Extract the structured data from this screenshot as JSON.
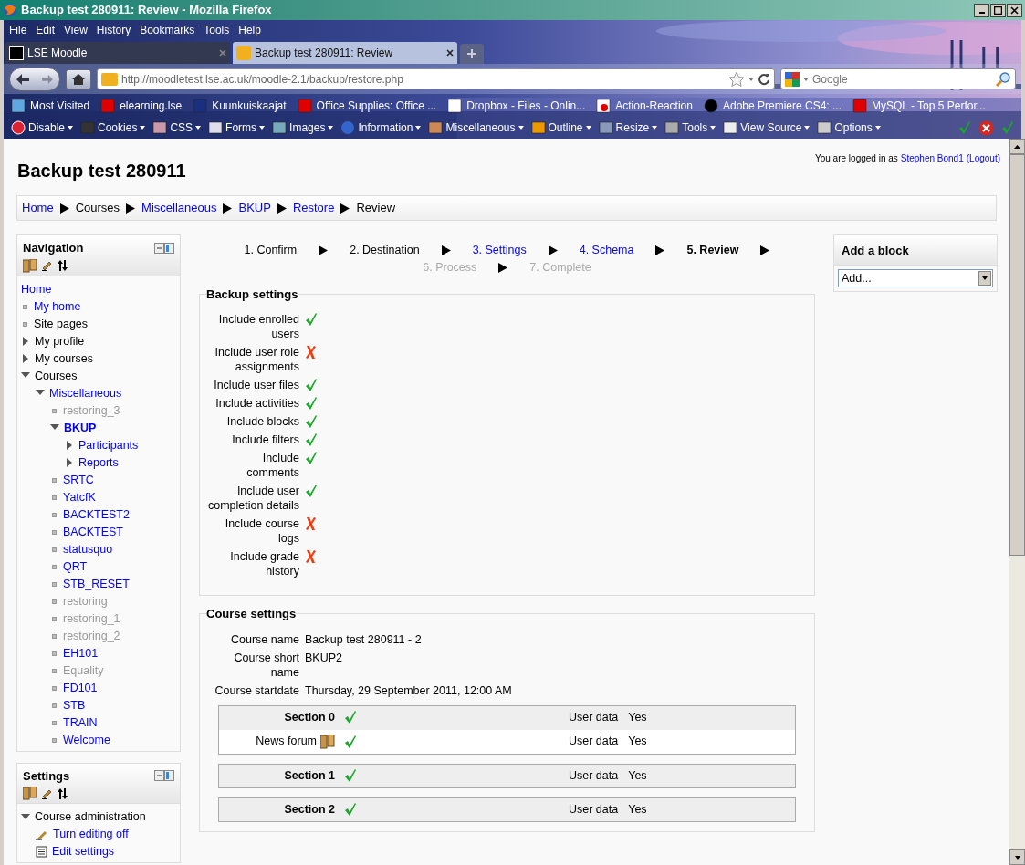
{
  "window": {
    "title": "Backup test 280911: Review - Mozilla Firefox"
  },
  "menu": [
    "File",
    "Edit",
    "View",
    "History",
    "Bookmarks",
    "Tools",
    "Help"
  ],
  "tabs": [
    {
      "label": "LSE Moodle",
      "selected": false
    },
    {
      "label": "Backup test 280911: Review",
      "selected": true
    }
  ],
  "address": {
    "url": "http://moodletest.lse.ac.uk/moodle-2.1/backup/restore.php"
  },
  "search": {
    "placeholder": "Google"
  },
  "bookmarks": [
    "Most Visited",
    "elearning.lse",
    "Kuunkuiskaajat",
    "Office Supplies: Office ...",
    "Dropbox - Files - Onlin...",
    "Action-Reaction",
    "Adobe Premiere CS4: ...",
    "MySQL - Top 5 Perfor..."
  ],
  "dev_toolbar": [
    "Disable",
    "Cookies",
    "CSS",
    "Forms",
    "Images",
    "Information",
    "Miscellaneous",
    "Outline",
    "Resize",
    "Tools",
    "View Source",
    "Options"
  ],
  "page": {
    "title": "Backup test 280911",
    "login_info": {
      "text": "You are logged in as",
      "user": "Stephen Bond1",
      "logout": "(Logout)"
    },
    "breadcrumb": [
      {
        "label": "Home",
        "link": true
      },
      {
        "label": "Courses",
        "link": false
      },
      {
        "label": "Miscellaneous",
        "link": true
      },
      {
        "label": "BKUP",
        "link": true
      },
      {
        "label": "Restore",
        "link": true
      },
      {
        "label": "Review",
        "link": false
      }
    ]
  },
  "navigation": {
    "title": "Navigation",
    "items": [
      {
        "label": "Home",
        "kind": "root"
      },
      {
        "label": "My home",
        "kind": "link"
      },
      {
        "label": "Site pages",
        "kind": "text"
      },
      {
        "label": "My profile",
        "kind": "text",
        "expanded": false
      },
      {
        "label": "My courses",
        "kind": "text",
        "expanded": false
      },
      {
        "label": "Courses",
        "kind": "text",
        "expanded": true,
        "children": [
          {
            "label": "Miscellaneous",
            "kind": "link",
            "expanded": true,
            "children": [
              {
                "label": "restoring_3",
                "kind": "dimmed"
              },
              {
                "label": "BKUP",
                "kind": "current",
                "expanded": true,
                "children": [
                  {
                    "label": "Participants",
                    "kind": "link",
                    "expanded": false
                  },
                  {
                    "label": "Reports",
                    "kind": "link",
                    "expanded": false
                  }
                ]
              },
              {
                "label": "SRTC",
                "kind": "link"
              },
              {
                "label": "YatcfK",
                "kind": "link"
              },
              {
                "label": "BACKTEST2",
                "kind": "link"
              },
              {
                "label": "BACKTEST",
                "kind": "link"
              },
              {
                "label": "statusquo",
                "kind": "link"
              },
              {
                "label": "QRT",
                "kind": "link"
              },
              {
                "label": "STB_RESET",
                "kind": "link"
              },
              {
                "label": "restoring",
                "kind": "dimmed"
              },
              {
                "label": "restoring_1",
                "kind": "dimmed"
              },
              {
                "label": "restoring_2",
                "kind": "dimmed"
              },
              {
                "label": "EH101",
                "kind": "link"
              },
              {
                "label": "Equality",
                "kind": "dimmed"
              },
              {
                "label": "FD101",
                "kind": "link"
              },
              {
                "label": "STB",
                "kind": "link"
              },
              {
                "label": "TRAIN",
                "kind": "link"
              },
              {
                "label": "Welcome",
                "kind": "link"
              }
            ]
          }
        ]
      }
    ]
  },
  "settings": {
    "title": "Settings",
    "items": [
      {
        "label": "Course administration",
        "kind": "text",
        "expanded": true,
        "children": [
          {
            "label": "Turn editing off",
            "kind": "action"
          },
          {
            "label": "Edit settings",
            "kind": "form"
          }
        ]
      }
    ]
  },
  "add_block": {
    "title": "Add a block",
    "value": "Add..."
  },
  "steps": [
    {
      "label": "1. Confirm",
      "kind": "done"
    },
    {
      "label": "2. Destination",
      "kind": "done"
    },
    {
      "label": "3. Settings",
      "kind": "link"
    },
    {
      "label": "4. Schema",
      "kind": "link"
    },
    {
      "label": "5. Review",
      "kind": "current"
    },
    {
      "label": "6. Process",
      "kind": "future"
    },
    {
      "label": "7. Complete",
      "kind": "future"
    }
  ],
  "backup_settings": {
    "legend": "Backup settings",
    "items": [
      {
        "label": "Include enrolled users",
        "included": true
      },
      {
        "label": "Include user role assignments",
        "included": false
      },
      {
        "label": "Include user files",
        "included": true
      },
      {
        "label": "Include activities",
        "included": true
      },
      {
        "label": "Include blocks",
        "included": true
      },
      {
        "label": "Include filters",
        "included": true
      },
      {
        "label": "Include comments",
        "included": true
      },
      {
        "label": "Include user completion details",
        "included": true
      },
      {
        "label": "Include course logs",
        "included": false
      },
      {
        "label": "Include grade history",
        "included": false
      }
    ]
  },
  "course_settings": {
    "legend": "Course settings",
    "fields": [
      {
        "label": "Course name",
        "value": "Backup test 280911 - 2"
      },
      {
        "label": "Course short name",
        "value": "BKUP2"
      },
      {
        "label": "Course startdate",
        "value": "Thursday, 29 September 2011, 12:00 AM"
      }
    ],
    "sections": [
      {
        "title": "Section 0",
        "included": true,
        "user_data_label": "User data",
        "user_data": "Yes",
        "activities": [
          {
            "name": "News forum",
            "included": true,
            "user_data_label": "User data",
            "user_data": "Yes"
          }
        ]
      },
      {
        "title": "Section 1",
        "included": true,
        "user_data_label": "User data",
        "user_data": "Yes"
      },
      {
        "title": "Section 2",
        "included": true,
        "user_data_label": "User data",
        "user_data": "Yes"
      }
    ]
  }
}
